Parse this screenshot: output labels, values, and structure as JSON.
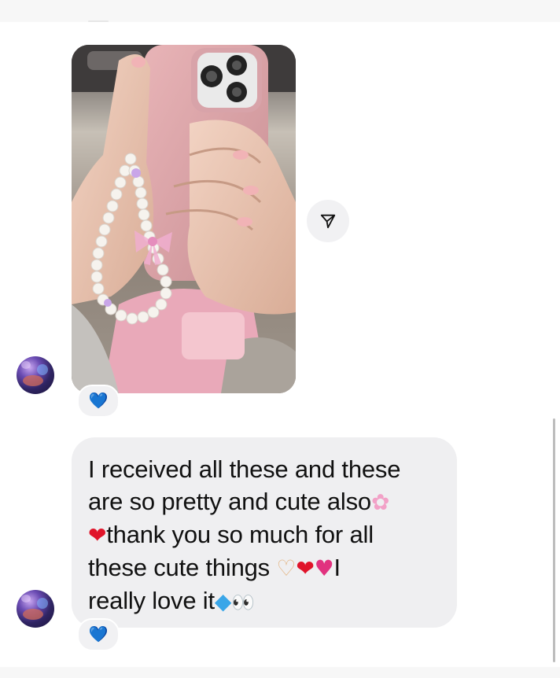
{
  "conversation": {
    "photo_message": {
      "media_description_icon": "photo",
      "share_icon": "send-icon",
      "reaction": "💙"
    },
    "text_message": {
      "lines": [
        "I received all these and these",
        "are so pretty and cute also",
        "thank you so much for all",
        "these cute things",
        "I",
        "really love it"
      ],
      "emojis": {
        "flower": "✿",
        "heart": "❤",
        "heart_hands": "♡",
        "sparkling_heart": "♥",
        "gem": "◆",
        "eyes": "👀"
      },
      "reaction": "💙"
    }
  },
  "colors": {
    "bubble_bg": "#efeff1",
    "reaction_blue": "#1877f2",
    "text": "#111111"
  }
}
